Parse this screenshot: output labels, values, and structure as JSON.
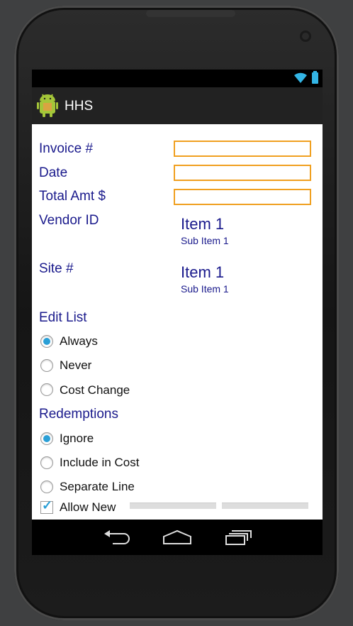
{
  "app": {
    "title": "HHS"
  },
  "form": {
    "invoice_label": "Invoice #",
    "date_label": "Date",
    "total_label": "Total Amt $",
    "vendor_label": "Vendor ID",
    "vendor_item": "Item 1",
    "vendor_subitem": "Sub Item 1",
    "site_label": "Site #",
    "site_item": "Item 1",
    "site_subitem": "Sub Item 1"
  },
  "edit_list": {
    "heading": "Edit List",
    "options": [
      {
        "label": "Always",
        "selected": true
      },
      {
        "label": "Never",
        "selected": false
      },
      {
        "label": "Cost Change",
        "selected": false
      }
    ]
  },
  "redemptions": {
    "heading": "Redemptions",
    "options": [
      {
        "label": "Ignore",
        "selected": true
      },
      {
        "label": "Include in Cost",
        "selected": false
      },
      {
        "label": "Separate Line",
        "selected": false
      }
    ]
  },
  "allow_new": {
    "label": "Allow New",
    "checked": true
  },
  "colors": {
    "accent": "#2a9fd6",
    "field_border": "#f0a020",
    "label": "#1a1a8c"
  },
  "icons": {
    "wifi": "wifi-icon",
    "battery": "battery-icon",
    "app": "android-icon",
    "back": "back-icon",
    "home": "home-icon",
    "recents": "recents-icon"
  }
}
